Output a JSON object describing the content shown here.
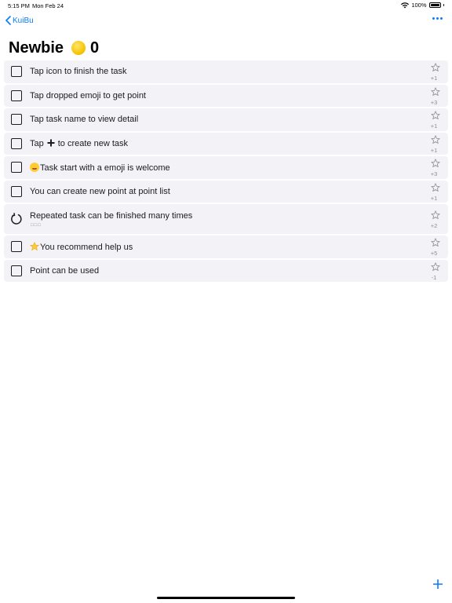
{
  "status_bar": {
    "time": "5:15 PM",
    "date": "Mon Feb 24",
    "battery": "100%",
    "wifi_icon": "wifi-icon",
    "battery_icon": "battery-icon"
  },
  "nav": {
    "back_label": "KuiBu",
    "more_icon": "ellipsis-icon"
  },
  "header": {
    "title": "Newbie",
    "coin_icon": "coin-icon",
    "points": "0"
  },
  "tasks": [
    {
      "text": "Tap icon to finish the task",
      "points": "+1",
      "type": "checkbox"
    },
    {
      "text": "Tap dropped emoji to get point",
      "points": "+3",
      "type": "checkbox"
    },
    {
      "text": "Tap task name to view detail",
      "points": "+1",
      "type": "checkbox"
    },
    {
      "text_before": "Tap",
      "text_after": "to create new task",
      "points": "+1",
      "type": "checkbox",
      "inline_icon": "plus-icon"
    },
    {
      "emoji": "🥳",
      "text": "Task start with a emoji is welcome",
      "points": "+3",
      "type": "checkbox"
    },
    {
      "text": "You can create new point at point list",
      "points": "+1",
      "type": "checkbox"
    },
    {
      "text": "Repeated task can be finished many times",
      "subtext": "□□□",
      "points": "+2",
      "type": "repeat"
    },
    {
      "emoji": "⭐",
      "text": "You recommend help us",
      "points": "+5",
      "type": "checkbox"
    },
    {
      "text": "Point can be used",
      "points": "-1",
      "type": "checkbox"
    }
  ],
  "colors": {
    "accent": "#0a7cf6",
    "row_background": "#f2f2f7",
    "secondary_text": "#8e8e93"
  },
  "bottom": {
    "add_icon": "plus-icon"
  }
}
